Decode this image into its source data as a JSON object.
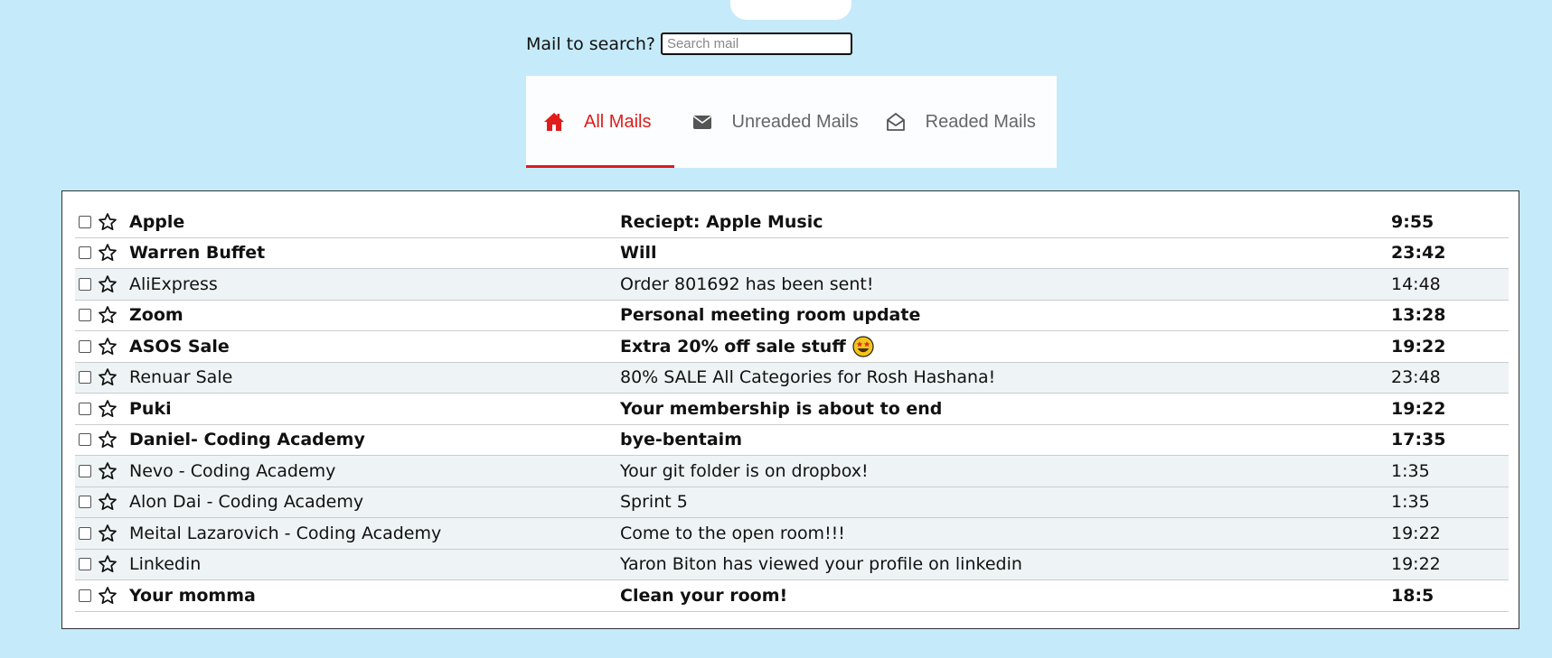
{
  "search": {
    "label": "Mail to search?",
    "placeholder": "Search mail",
    "value": ""
  },
  "tabs": [
    {
      "label": "All Mails",
      "icon": "home-icon",
      "active": true
    },
    {
      "label": "Unreaded Mails",
      "icon": "envelope-icon",
      "active": false
    },
    {
      "label": "Readed Mails",
      "icon": "open-envelope-icon",
      "active": false
    }
  ],
  "colors": {
    "background": "#c5eaf9",
    "accent": "#e01c1c",
    "read_row": "#eef3f5"
  },
  "mails": [
    {
      "sender": "Apple",
      "subject": "Reciept: Apple Music",
      "time": "9:55",
      "read": false,
      "starred": false
    },
    {
      "sender": "Warren Buffet",
      "subject": "Will",
      "time": "23:42",
      "read": false,
      "starred": false
    },
    {
      "sender": "AliExpress",
      "subject": "Order 801692 has been sent!",
      "time": "14:48",
      "read": true,
      "starred": false
    },
    {
      "sender": "Zoom",
      "subject": "Personal meeting room update",
      "time": "13:28",
      "read": false,
      "starred": false
    },
    {
      "sender": "ASOS Sale",
      "subject": "Extra 20% off sale stuff",
      "emoji": "star-struck-emoji",
      "time": "19:22",
      "read": false,
      "starred": false
    },
    {
      "sender": "Renuar Sale",
      "subject": "80% SALE All Categories for Rosh Hashana!",
      "time": "23:48",
      "read": true,
      "starred": false
    },
    {
      "sender": "Puki",
      "subject": "Your membership is about to end",
      "time": "19:22",
      "read": false,
      "starred": false
    },
    {
      "sender": "Daniel- Coding Academy",
      "subject": "bye-bentaim",
      "time": "17:35",
      "read": false,
      "starred": false
    },
    {
      "sender": "Nevo - Coding Academy",
      "subject": "Your git folder is on dropbox!",
      "time": "1:35",
      "read": true,
      "starred": false
    },
    {
      "sender": "Alon Dai - Coding Academy",
      "subject": "Sprint 5",
      "time": "1:35",
      "read": true,
      "starred": false
    },
    {
      "sender": "Meital Lazarovich - Coding Academy",
      "subject": "Come to the open room!!!",
      "time": "19:22",
      "read": true,
      "starred": false
    },
    {
      "sender": "Linkedin",
      "subject": "Yaron Biton has viewed your profile on linkedin",
      "time": "19:22",
      "read": true,
      "starred": false
    },
    {
      "sender": "Your momma",
      "subject": "Clean your room!",
      "time": "18:5",
      "read": false,
      "starred": false
    }
  ]
}
